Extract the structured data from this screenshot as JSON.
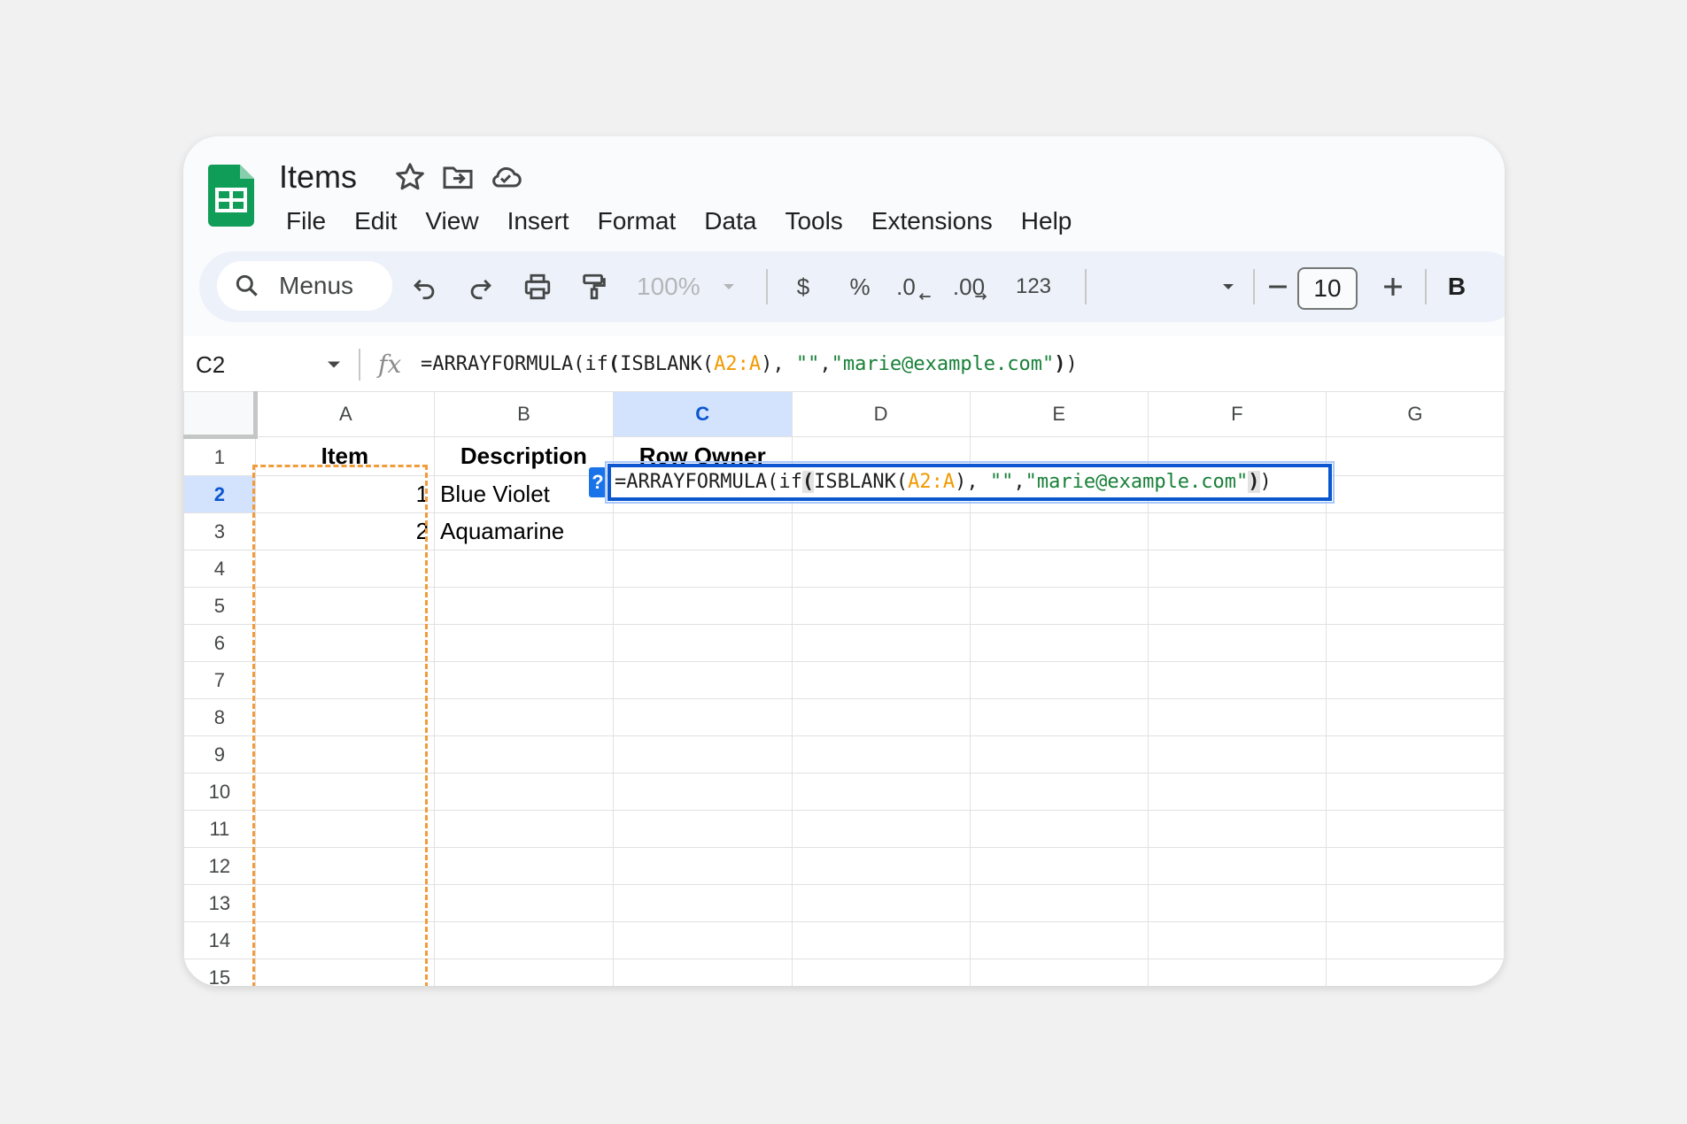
{
  "app": {
    "doc_title": "Items",
    "menus": [
      "File",
      "Edit",
      "View",
      "Insert",
      "Format",
      "Data",
      "Tools",
      "Extensions",
      "Help"
    ]
  },
  "toolbar": {
    "search_label": "Menus",
    "zoom": "100%",
    "currency": "$",
    "percent": "%",
    "decrease_decimal": ".0",
    "increase_decimal": ".00",
    "number_format": "123",
    "font_size": "10",
    "bold": "B"
  },
  "formula_bar": {
    "name_box": "C2",
    "fx": "fx",
    "formula_parts": [
      "=ARRAYFORMULA(if",
      "(",
      "ISBLANK(",
      "A2:A",
      "), ",
      "\"\"",
      ",",
      "\"marie@example.com\"",
      ")",
      ")"
    ]
  },
  "grid": {
    "columns": [
      "A",
      "B",
      "C",
      "D",
      "E",
      "F",
      "G"
    ],
    "active_column": "C",
    "active_row": "2",
    "rows": [
      {
        "num": "1",
        "cells": [
          "Item",
          "Description",
          "Row Owner",
          "",
          "",
          "",
          ""
        ]
      },
      {
        "num": "2",
        "cells": [
          "1",
          "Blue Violet",
          "",
          "",
          "",
          "",
          ""
        ]
      },
      {
        "num": "3",
        "cells": [
          "2",
          "Aquamarine",
          "",
          "",
          "",
          "",
          ""
        ]
      },
      {
        "num": "4",
        "cells": [
          "",
          "",
          "",
          "",
          "",
          "",
          ""
        ]
      },
      {
        "num": "5",
        "cells": [
          "",
          "",
          "",
          "",
          "",
          "",
          ""
        ]
      },
      {
        "num": "6",
        "cells": [
          "",
          "",
          "",
          "",
          "",
          "",
          ""
        ]
      },
      {
        "num": "7",
        "cells": [
          "",
          "",
          "",
          "",
          "",
          "",
          ""
        ]
      },
      {
        "num": "8",
        "cells": [
          "",
          "",
          "",
          "",
          "",
          "",
          ""
        ]
      },
      {
        "num": "9",
        "cells": [
          "",
          "",
          "",
          "",
          "",
          "",
          ""
        ]
      },
      {
        "num": "10",
        "cells": [
          "",
          "",
          "",
          "",
          "",
          "",
          ""
        ]
      },
      {
        "num": "11",
        "cells": [
          "",
          "",
          "",
          "",
          "",
          "",
          ""
        ]
      },
      {
        "num": "12",
        "cells": [
          "",
          "",
          "",
          "",
          "",
          "",
          ""
        ]
      },
      {
        "num": "13",
        "cells": [
          "",
          "",
          "",
          "",
          "",
          "",
          ""
        ]
      },
      {
        "num": "14",
        "cells": [
          "",
          "",
          "",
          "",
          "",
          "",
          ""
        ]
      },
      {
        "num": "15",
        "cells": [
          "",
          "",
          "",
          "",
          "",
          "",
          ""
        ]
      }
    ]
  },
  "editor": {
    "help_chip": "?"
  },
  "colors": {
    "sheets_green": "#0f9d58",
    "selection_blue": "#0b57d0",
    "range_ref_orange": "#f29900",
    "string_green": "#188038",
    "copy_border": "#f29b38"
  }
}
